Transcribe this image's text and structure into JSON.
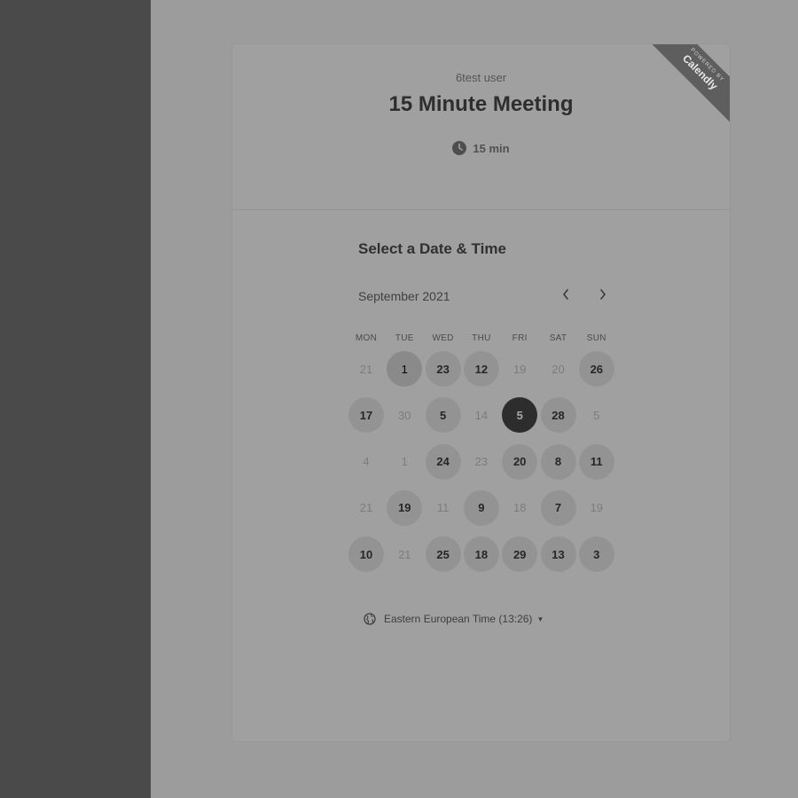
{
  "event": {
    "host_name": "6test user",
    "title": "15 Minute Meeting",
    "duration": "15 min"
  },
  "badge": {
    "small_text": "POWERED BY",
    "brand": "Calendly"
  },
  "calendar": {
    "heading": "Select a Date & Time",
    "month": "September 2021",
    "weekdays": [
      "MON",
      "TUE",
      "WED",
      "THU",
      "FRI",
      "SAT",
      "SUN"
    ],
    "weeks": [
      [
        {
          "label": "21",
          "state": "disabled"
        },
        {
          "label": "1",
          "state": "today"
        },
        {
          "label": "23",
          "state": "available"
        },
        {
          "label": "12",
          "state": "available"
        },
        {
          "label": "19",
          "state": "disabled"
        },
        {
          "label": "20",
          "state": "disabled"
        },
        {
          "label": "26",
          "state": "available"
        }
      ],
      [
        {
          "label": "17",
          "state": "available"
        },
        {
          "label": "30",
          "state": "disabled"
        },
        {
          "label": "5",
          "state": "available"
        },
        {
          "label": "14",
          "state": "disabled"
        },
        {
          "label": "5",
          "state": "selected"
        },
        {
          "label": "28",
          "state": "available"
        },
        {
          "label": "5",
          "state": "disabled"
        }
      ],
      [
        {
          "label": "4",
          "state": "disabled"
        },
        {
          "label": "1",
          "state": "disabled"
        },
        {
          "label": "24",
          "state": "available"
        },
        {
          "label": "23",
          "state": "disabled"
        },
        {
          "label": "20",
          "state": "available"
        },
        {
          "label": "8",
          "state": "available"
        },
        {
          "label": "11",
          "state": "available"
        }
      ],
      [
        {
          "label": "21",
          "state": "disabled"
        },
        {
          "label": "19",
          "state": "available"
        },
        {
          "label": "11",
          "state": "disabled"
        },
        {
          "label": "9",
          "state": "available"
        },
        {
          "label": "18",
          "state": "disabled"
        },
        {
          "label": "7",
          "state": "available"
        },
        {
          "label": "19",
          "state": "disabled"
        }
      ],
      [
        {
          "label": "10",
          "state": "available"
        },
        {
          "label": "21",
          "state": "disabled"
        },
        {
          "label": "25",
          "state": "available"
        },
        {
          "label": "18",
          "state": "available"
        },
        {
          "label": "29",
          "state": "available"
        },
        {
          "label": "13",
          "state": "available"
        },
        {
          "label": "3",
          "state": "available"
        }
      ]
    ]
  },
  "timezone": {
    "label": "Eastern European Time (13:26)"
  },
  "icons": {
    "duration": "clock-icon",
    "prev": "chevron-left-icon",
    "next": "chevron-right-icon",
    "timezone": "globe-icon",
    "dropdown": "caret-down-icon"
  },
  "colors": {
    "overlay_bg": "#9c9c9c",
    "sidebar": "#4a4a4a",
    "selected_day": "#2d2d2d",
    "available_day": "#939393"
  }
}
